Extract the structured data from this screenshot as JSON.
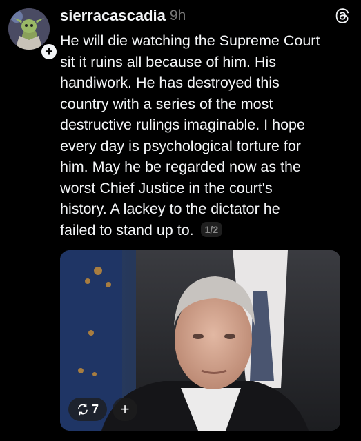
{
  "post": {
    "username": "sierracascadia",
    "timestamp": "9h",
    "follow_icon": "plus",
    "lines": [
      "He will die watching the Supreme Court",
      "sit it ruins all because of him. His",
      "handiwork. He has destroyed this",
      "country with a series of the most",
      "destructive rulings imaginable. I hope",
      "every day is psychological torture for",
      "him. May he be regarded now as the",
      "worst Chief Justice in the court's",
      "history. A lackey to the dictator he",
      "failed to stand up to."
    ],
    "page_indicator": "1/2"
  },
  "media": {
    "repost_count": "7",
    "add_label": "+"
  },
  "colors": {
    "background": "#000000",
    "text": "#f3f5f7",
    "muted": "#777777"
  }
}
